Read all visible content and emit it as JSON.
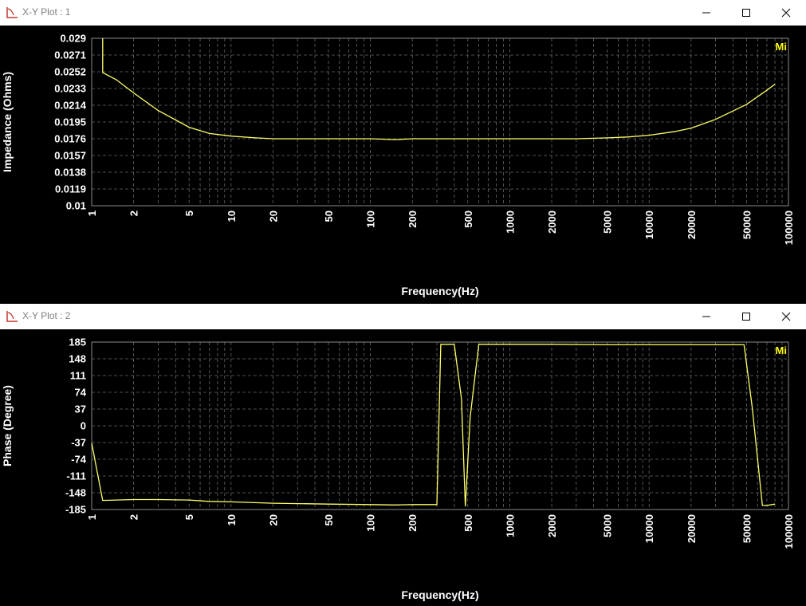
{
  "windows": [
    {
      "title": "X-Y Plot : 1",
      "controls": {
        "minimize_icon": "minimize-icon",
        "maximize_icon": "maximize-icon",
        "close_icon": "close-icon"
      }
    },
    {
      "title": "X-Y Plot : 2",
      "controls": {
        "minimize_icon": "minimize-icon",
        "maximize_icon": "maximize-icon",
        "close_icon": "close-icon"
      }
    }
  ],
  "colors": {
    "background": "#000000",
    "grid": "#8a8a8a",
    "trace": "#ffff66",
    "text": "#ffffff",
    "badge": "#ffff00"
  },
  "chart_data": [
    {
      "type": "line",
      "title": "",
      "xlabel": "Frequency(Hz)",
      "ylabel": "Impedance (Ohms)",
      "x_scale": "log",
      "xlim": [
        1,
        100000
      ],
      "ylim": [
        0.01,
        0.029
      ],
      "x_tick_labels": [
        "1",
        "2",
        "5",
        "10",
        "20",
        "50",
        "100",
        "200",
        "500",
        "1000",
        "2000",
        "5000",
        "10000",
        "20000",
        "50000",
        "100000"
      ],
      "y_tick_labels": [
        "0.029",
        "0.0271",
        "0.0252",
        "0.0233",
        "0.0214",
        "0.0195",
        "0.0176",
        "0.0157",
        "0.0138",
        "0.0119",
        "0.01"
      ],
      "grid": true,
      "badge": "Mi",
      "series": [
        {
          "x": [
            1.2,
            1.2,
            1.5,
            2,
            3,
            5,
            7,
            10,
            15,
            20,
            30,
            50,
            100,
            150,
            200,
            300,
            500,
            1000,
            2000,
            3000,
            5000,
            7000,
            10000,
            15000,
            20000,
            30000,
            50000,
            70000,
            80000
          ],
          "y": [
            0.029,
            0.0251,
            0.0243,
            0.0228,
            0.0208,
            0.0189,
            0.0182,
            0.0179,
            0.0177,
            0.0176,
            0.0176,
            0.0176,
            0.0176,
            0.0175,
            0.0176,
            0.0176,
            0.0176,
            0.0176,
            0.0176,
            0.0176,
            0.0177,
            0.0178,
            0.018,
            0.0184,
            0.0188,
            0.0198,
            0.0215,
            0.0231,
            0.0238
          ]
        }
      ]
    },
    {
      "type": "line",
      "title": "",
      "xlabel": "Frequency(Hz)",
      "ylabel": "Phase (Degree)",
      "x_scale": "log",
      "xlim": [
        1,
        100000
      ],
      "ylim": [
        -185,
        185
      ],
      "x_tick_labels": [
        "1",
        "2",
        "5",
        "10",
        "20",
        "50",
        "100",
        "200",
        "500",
        "1000",
        "2000",
        "5000",
        "10000",
        "20000",
        "50000",
        "100000"
      ],
      "y_tick_labels": [
        "185",
        "148",
        "111",
        "74",
        "37",
        "0",
        "-37",
        "-74",
        "-111",
        "-148",
        "-185"
      ],
      "grid": true,
      "badge": "Mi",
      "series": [
        {
          "x": [
            1,
            1.2,
            1.5,
            2,
            3,
            5,
            7,
            10,
            20,
            50,
            100,
            150,
            200,
            250,
            300,
            320,
            370,
            400,
            450,
            480,
            520,
            600,
            700,
            1000,
            2000,
            5000,
            10000,
            20000,
            30000,
            45000,
            48000,
            55000,
            65000,
            70000,
            80000
          ],
          "y": [
            -38,
            -165,
            -164,
            -163,
            -163,
            -164,
            -167,
            -168,
            -171,
            -173,
            -174,
            -175,
            -174,
            -174,
            -174,
            180,
            180,
            180,
            60,
            -178,
            20,
            180,
            180,
            180,
            180,
            179,
            179,
            179,
            179,
            179,
            179,
            40,
            -176,
            -176,
            -173
          ]
        }
      ]
    }
  ]
}
